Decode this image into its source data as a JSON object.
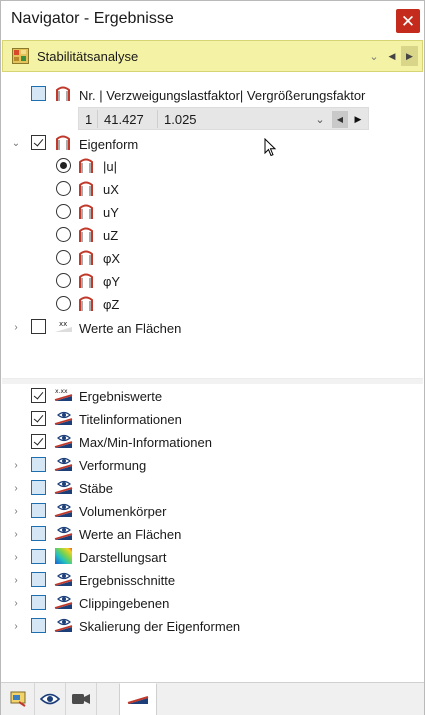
{
  "window": {
    "title": "Navigator - Ergebnisse",
    "close_glyph": "✕"
  },
  "mode_bar": {
    "label": "Stabilitätsanalyse",
    "icon": "stability-analysis-icon",
    "highlight_color": "#f4f2a4"
  },
  "mode_selector": {
    "header": "Nr. | Verzweigungslastfaktor| Vergrößerungsfaktor",
    "nr": "1",
    "verzweigungslastfaktor": "41.427",
    "vergroesserungsfaktor": "1.025"
  },
  "eigenform": {
    "label": "Eigenform",
    "options": [
      {
        "label": "|u|",
        "selected": true
      },
      {
        "label": "uX",
        "selected": false
      },
      {
        "label": "uY",
        "selected": false
      },
      {
        "label": "uZ",
        "selected": false
      },
      {
        "label": "φX",
        "selected": false
      },
      {
        "label": "φY",
        "selected": false
      },
      {
        "label": "φZ",
        "selected": false
      }
    ]
  },
  "werte_an_flaechen_top": {
    "label": "Werte an Flächen"
  },
  "display_items": [
    {
      "label": "Ergebniswerte",
      "checked": true,
      "expandable": false
    },
    {
      "label": "Titelinformationen",
      "checked": true,
      "expandable": false
    },
    {
      "label": "Max/Min-Informationen",
      "checked": true,
      "expandable": false
    },
    {
      "label": "Verformung",
      "checked": false,
      "expandable": true
    },
    {
      "label": "Stäbe",
      "checked": false,
      "expandable": true
    },
    {
      "label": "Volumenkörper",
      "checked": false,
      "expandable": true
    },
    {
      "label": "Werte an Flächen",
      "checked": false,
      "expandable": true
    },
    {
      "label": "Darstellungsart",
      "checked": false,
      "expandable": true
    },
    {
      "label": "Ergebnisschnitte",
      "checked": false,
      "expandable": true
    },
    {
      "label": "Clippingebenen",
      "checked": false,
      "expandable": true
    },
    {
      "label": "Skalierung der Eigenformen",
      "checked": false,
      "expandable": true
    }
  ],
  "tabs": [
    "data-tab-icon",
    "view-tab-icon",
    "camera-tab-icon",
    "results-tab-icon"
  ],
  "colors": {
    "close": "#c42b1c",
    "checkbox_border": "#1e6fb0",
    "checkbox_fill": "#d5e6f5",
    "shape_icon": "#c0392b"
  }
}
